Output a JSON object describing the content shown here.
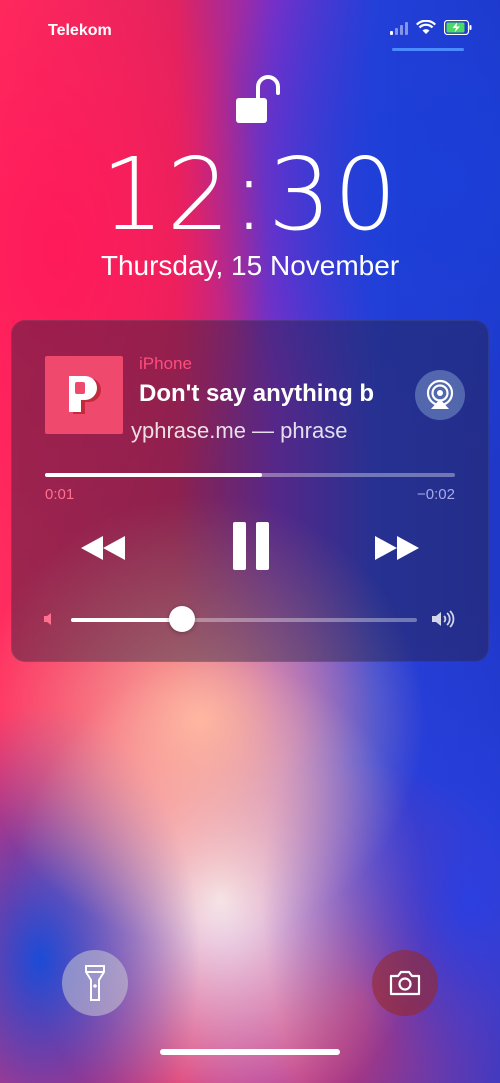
{
  "status_bar": {
    "carrier": "Telekom",
    "signal_bars_active": 1,
    "signal_bars_total": 4,
    "battery_level": 0.8,
    "battery_charging": true
  },
  "lockscreen": {
    "time": "12:30",
    "date": "Thursday, 15 November",
    "lock_state": "unlocked"
  },
  "now_playing": {
    "source": "iPhone",
    "title": "Don't say anything b",
    "subtitle": "yphrase.me — phrase",
    "elapsed": "0:01",
    "remaining": "−0:02",
    "progress": 0.53,
    "volume": 0.32,
    "artwork_letter_icon": "phrase-app-icon"
  },
  "colors": {
    "source_label": "#ff4d7c",
    "artwork_bg": "#ef4a6e",
    "cc_indicator": "#4a8cff"
  },
  "icons": {
    "lock": "unlocked-padlock-icon",
    "airplay": "airplay-audio-icon",
    "flashlight": "flashlight-icon",
    "camera": "camera-icon"
  }
}
